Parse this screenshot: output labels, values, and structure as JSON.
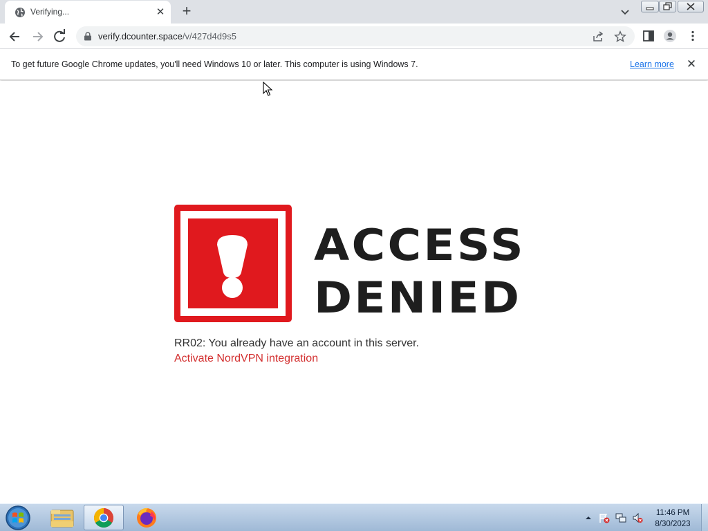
{
  "browser": {
    "tab": {
      "title": "Verifying...",
      "favicon": "globe-icon",
      "close_icon": "close-icon"
    },
    "new_tab_icon": "plus-icon",
    "tab_search_icon": "chevron-down-icon",
    "window_controls": [
      "minimize-icon",
      "restore-icon",
      "close-icon"
    ]
  },
  "toolbar": {
    "back_icon": "arrow-left-icon",
    "forward_icon": "arrow-right-icon",
    "reload_icon": "reload-icon",
    "url_host": "verify.dcounter.space",
    "url_path": "/v/427d4d9s5",
    "lock_icon": "lock-icon",
    "share_icon": "share-icon",
    "bookmark_icon": "star-icon",
    "side_panel_icon": "side-panel-icon",
    "profile_icon": "profile-icon",
    "menu_icon": "kebab-menu-icon"
  },
  "infobar": {
    "message": "To get future Google Chrome updates, you'll need Windows 10 or later. This computer is using Windows 7.",
    "link": "Learn more"
  },
  "page": {
    "heading_line1": "ACCESS",
    "heading_line2": "DENIED",
    "error_message": "RR02: You already have an account in this server.",
    "action_link": "Activate NordVPN integration",
    "colors": {
      "alert_red": "#e0191e",
      "heading": "#1e1e1e",
      "link_red": "#d32f2f"
    }
  },
  "taskbar": {
    "apps": [
      "windows-start-icon",
      "file-explorer-icon",
      "chrome-icon",
      "firefox-icon"
    ],
    "active_app": "chrome-icon",
    "tray_icons": [
      "tray-arrow-icon",
      "action-center-flag-icon",
      "network-icon",
      "volume-muted-icon"
    ],
    "time": "11:46 PM",
    "date": "8/30/2023"
  }
}
